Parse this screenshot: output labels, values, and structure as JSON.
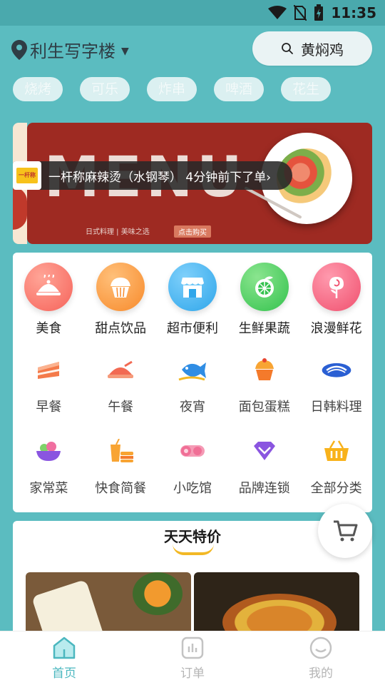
{
  "status_bar": {
    "time": "11:35"
  },
  "header": {
    "location": "利生写字楼",
    "search_placeholder": "黄焖鸡"
  },
  "hot_tags": [
    "烧烤",
    "可乐",
    "炸串",
    "啤酒",
    "花生"
  ],
  "banner": {
    "menu_text": "MENU",
    "subtitle": "日式料理 | 美味之选",
    "cta": "点击购买",
    "order_toast": {
      "shop_logo_text": "一杆称",
      "message": "一杆称麻辣烫（水钢琴） 4分钟前下了单›"
    }
  },
  "main_categories": [
    {
      "label": "美食",
      "icon": "food-cloche-icon",
      "color": "#f6635a"
    },
    {
      "label": "甜点饮品",
      "icon": "cupcake-icon",
      "color": "#f78a2b"
    },
    {
      "label": "超市便利",
      "icon": "store-icon",
      "color": "#2fa6ea"
    },
    {
      "label": "生鲜果蔬",
      "icon": "orange-fruit-icon",
      "color": "#33c24d"
    },
    {
      "label": "浪漫鲜花",
      "icon": "rose-icon",
      "color": "#f0506e"
    }
  ],
  "sub_categories_row1": [
    {
      "label": "早餐",
      "icon": "cake-slice-icon"
    },
    {
      "label": "午餐",
      "icon": "dish-icon"
    },
    {
      "label": "夜宵",
      "icon": "fish-icon"
    },
    {
      "label": "面包蛋糕",
      "icon": "cupcake-icon"
    },
    {
      "label": "日韩料理",
      "icon": "sushi-icon"
    }
  ],
  "sub_categories_row2": [
    {
      "label": "家常菜",
      "icon": "bowl-icon"
    },
    {
      "label": "快食简餐",
      "icon": "fastfood-icon"
    },
    {
      "label": "小吃馆",
      "icon": "roll-snack-icon"
    },
    {
      "label": "品牌连锁",
      "icon": "diamond-icon"
    },
    {
      "label": "全部分类",
      "icon": "basket-icon"
    }
  ],
  "deals": {
    "title": "天天特价"
  },
  "bottom_nav": [
    {
      "label": "首页",
      "icon": "home-icon",
      "active": true
    },
    {
      "label": "订单",
      "icon": "order-icon",
      "active": false
    },
    {
      "label": "我的",
      "icon": "profile-icon",
      "active": false
    }
  ]
}
